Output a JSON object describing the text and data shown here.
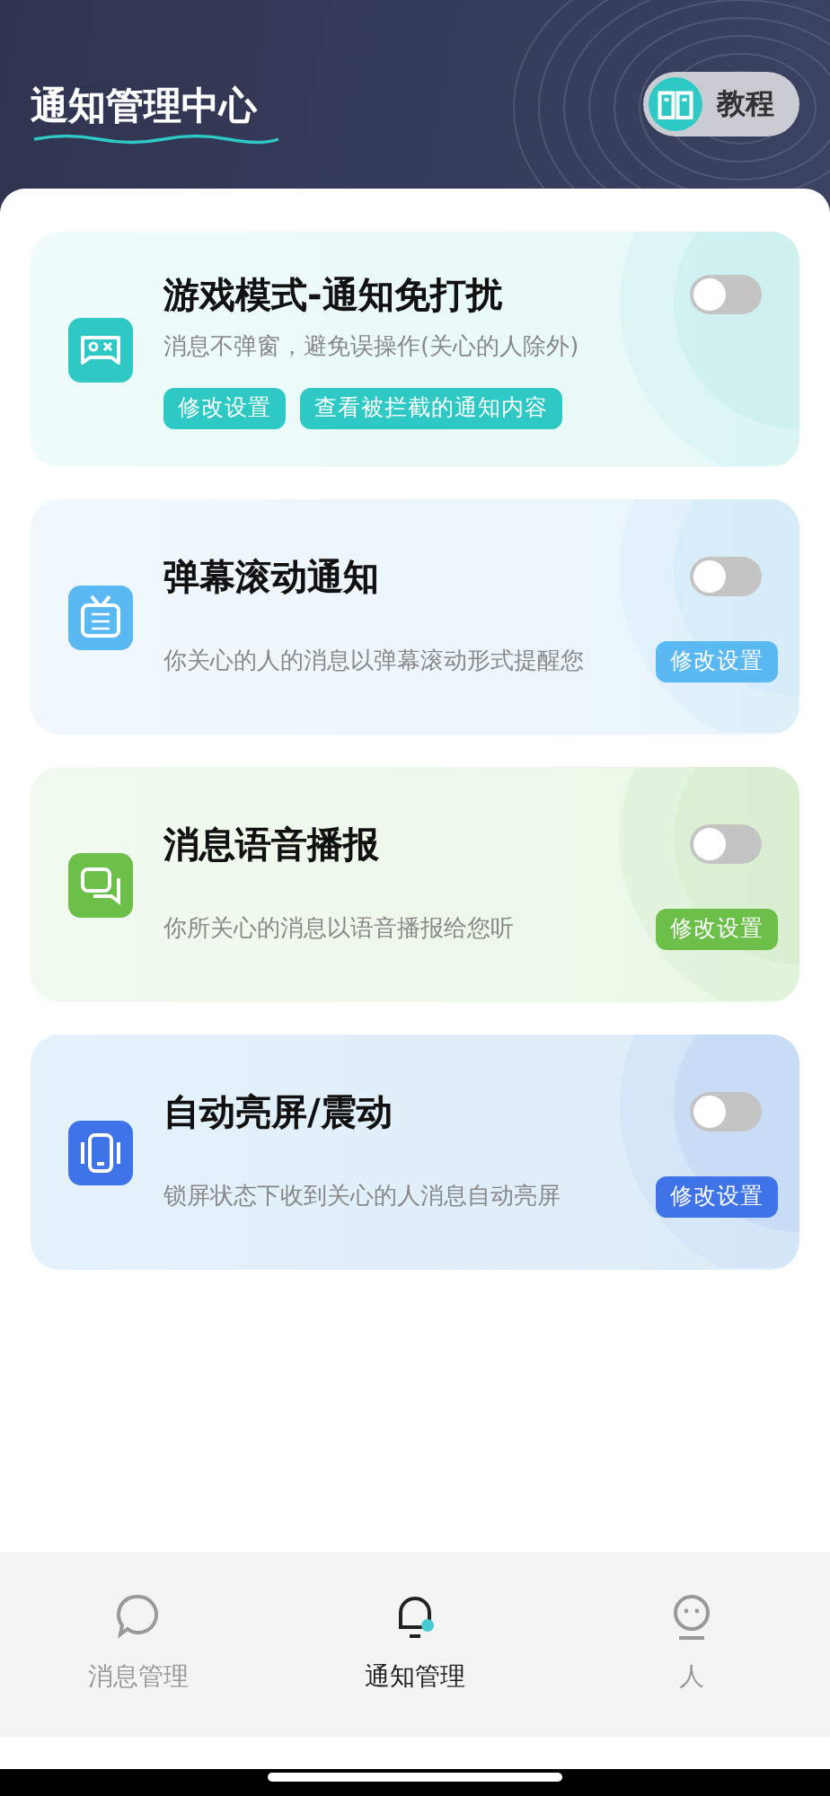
{
  "header": {
    "title": "通知管理中心",
    "tutorial_button": "教程"
  },
  "cards": [
    {
      "kind": "game",
      "title": "游戏模式-通知免打扰",
      "description": "消息不弹窗，避免误操作(关心的人除外)",
      "on": false,
      "color": "#2ec9c4",
      "buttons": [
        "修改设置",
        "查看被拦截的通知内容"
      ]
    },
    {
      "kind": "danmaku",
      "title": "弹幕滚动通知",
      "description": "你关心的人的消息以弹幕滚动形式提醒您",
      "on": false,
      "color": "#5ab8f2",
      "buttons": [
        "修改设置"
      ]
    },
    {
      "kind": "voice",
      "title": "消息语音播报",
      "description": "你所关心的消息以语音播报给您听",
      "on": false,
      "color": "#6cc04a",
      "buttons": [
        "修改设置"
      ]
    },
    {
      "kind": "screen",
      "title": "自动亮屏/震动",
      "description": "锁屏状态下收到关心的人消息自动亮屏",
      "on": false,
      "color": "#3f73e8",
      "buttons": [
        "修改设置"
      ]
    }
  ],
  "tab_bar": [
    {
      "kind": "chat",
      "label": "消息管理",
      "selected": false
    },
    {
      "kind": "bell",
      "label": "通知管理",
      "selected": true
    },
    {
      "kind": "face",
      "label": "人",
      "selected": false
    }
  ]
}
